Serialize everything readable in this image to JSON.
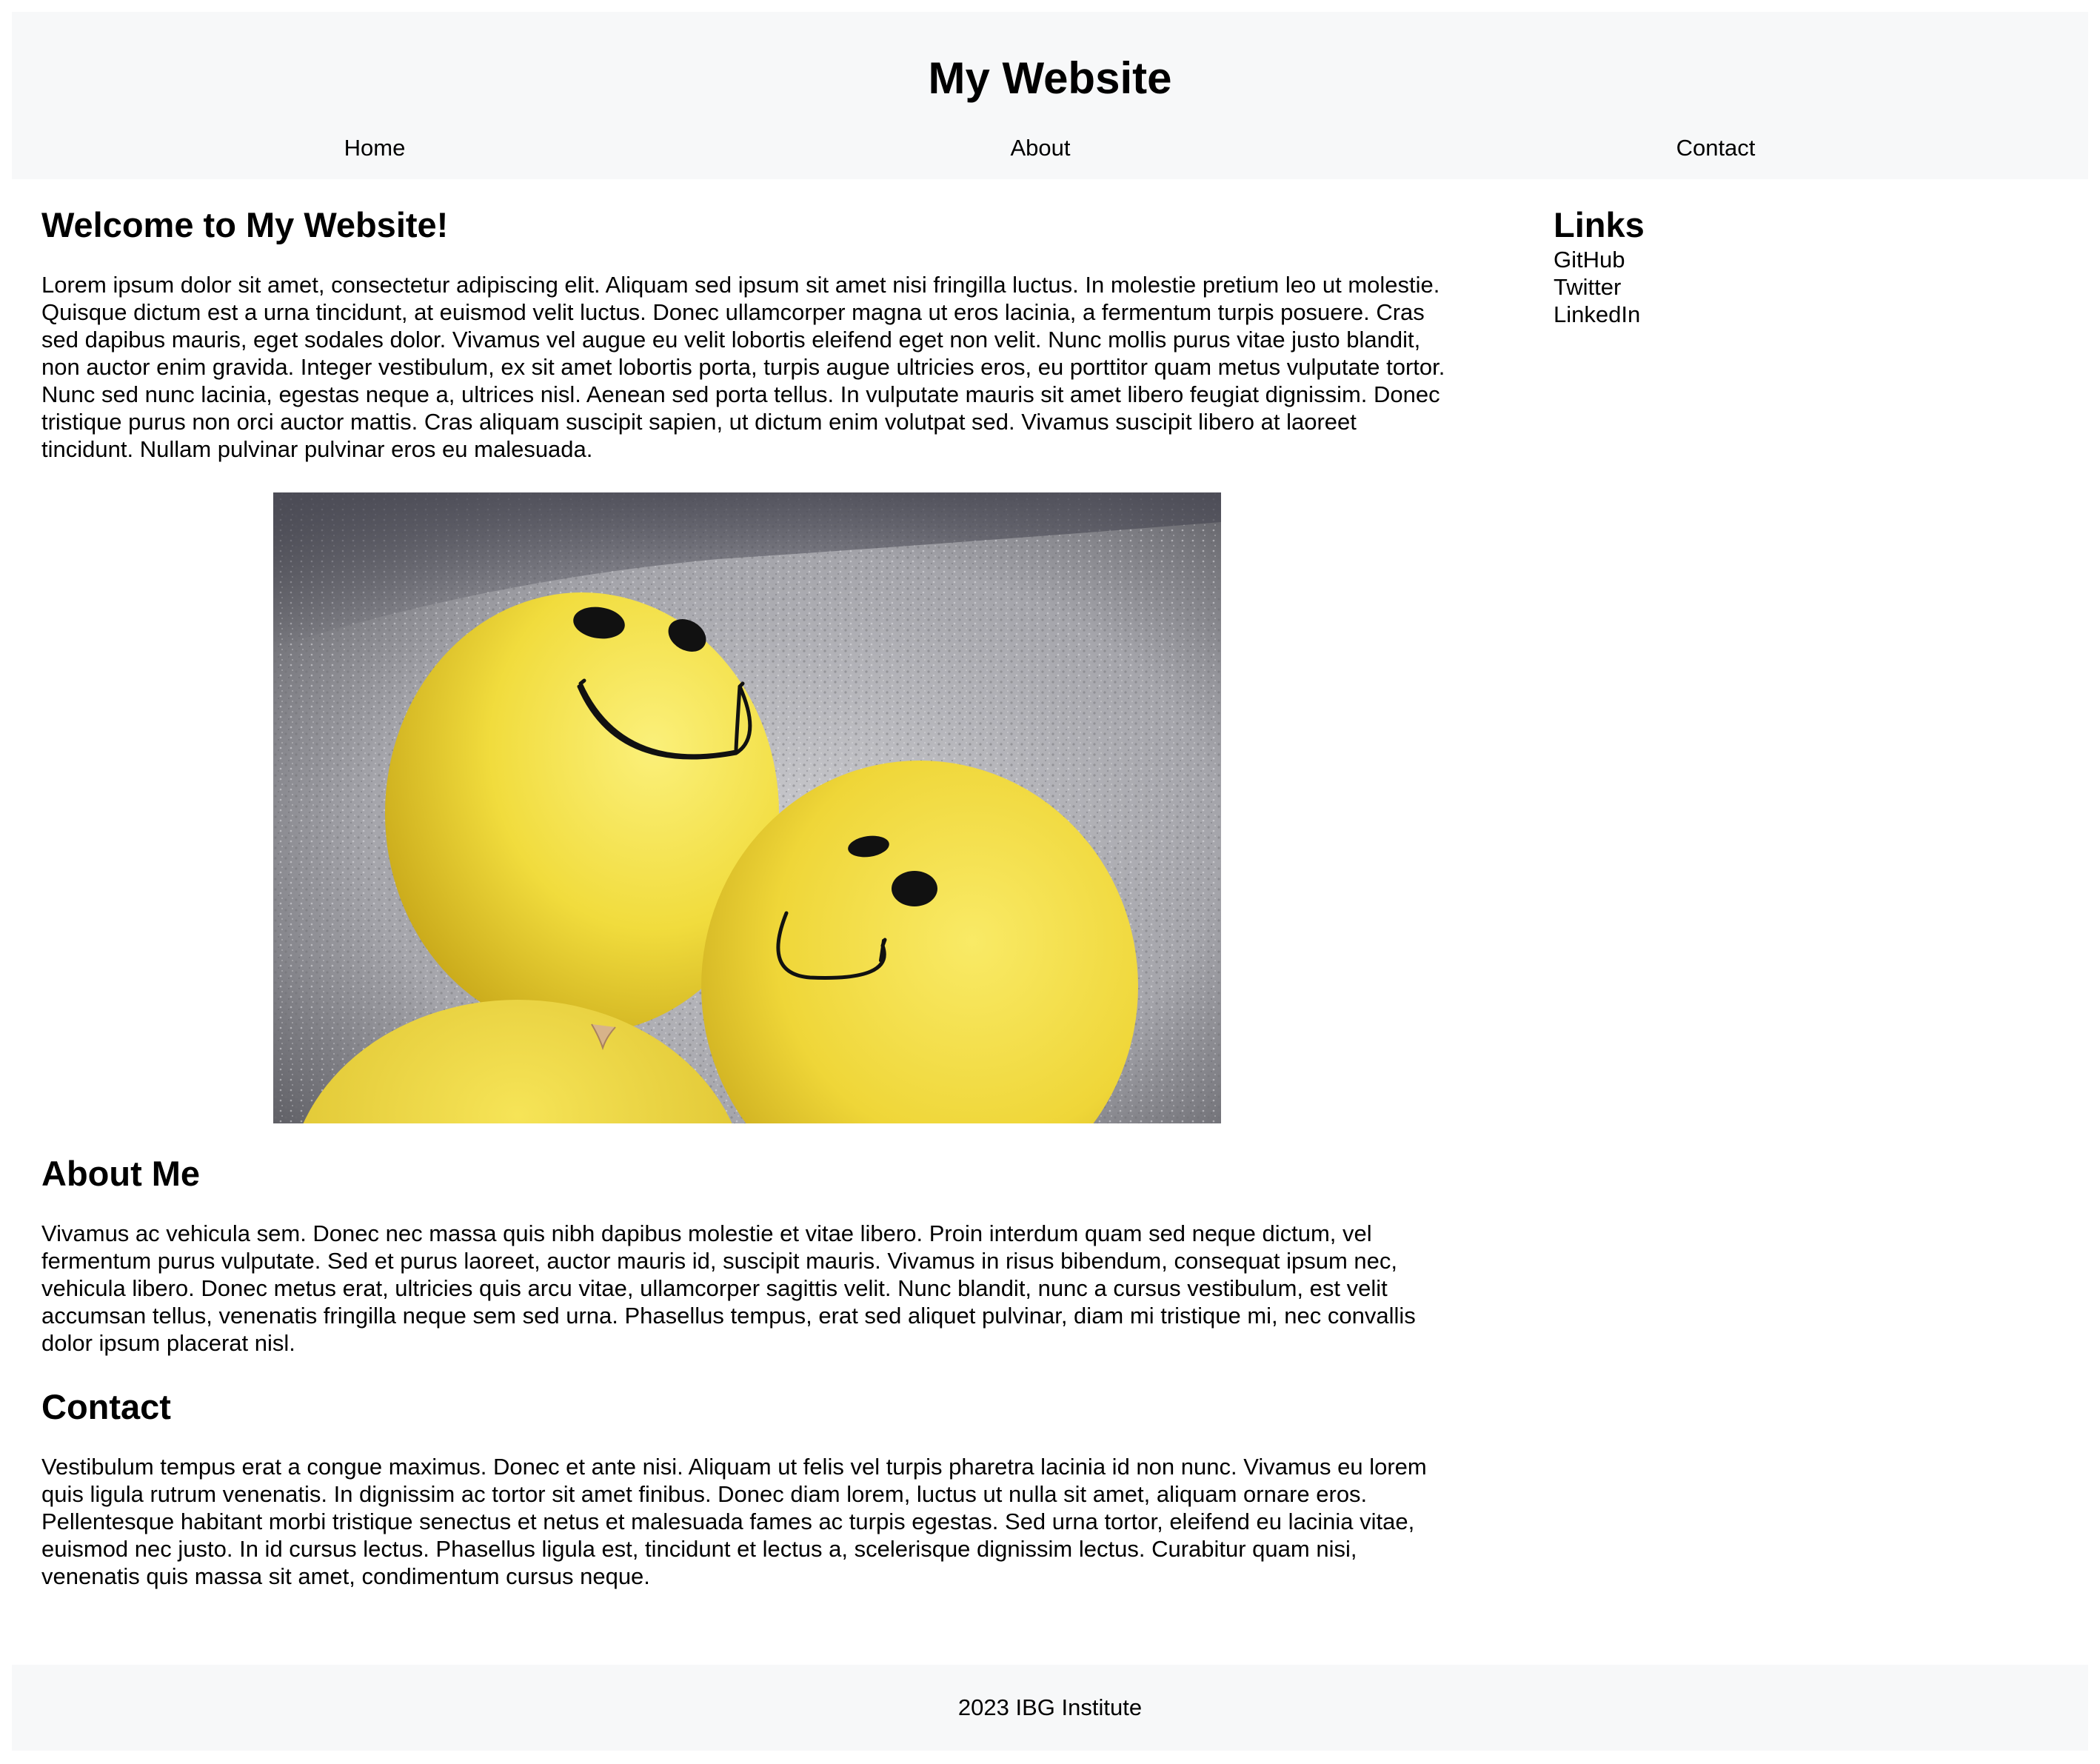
{
  "header": {
    "title": "My Website",
    "nav": [
      "Home",
      "About",
      "Contact"
    ]
  },
  "main": {
    "welcome": {
      "heading": "Welcome to My Website!",
      "body": "Lorem ipsum dolor sit amet, consectetur adipiscing elit. Aliquam sed ipsum sit amet nisi fringilla luctus. In molestie pretium leo ut molestie. Quisque dictum est a urna tincidunt, at euismod velit luctus. Donec ullamcorper magna ut eros lacinia, a fermentum turpis posuere. Cras sed dapibus mauris, eget sodales dolor. Vivamus vel augue eu velit lobortis eleifend eget non velit. Nunc mollis purus vitae justo blandit, non auctor enim gravida. Integer vestibulum, ex sit amet lobortis porta, turpis augue ultricies eros, eu porttitor quam metus vulputate tortor. Nunc sed nunc lacinia, egestas neque a, ultrices nisl. Aenean sed porta tellus. In vulputate mauris sit amet libero feugiat dignissim. Donec tristique purus non orci auctor mattis. Cras aliquam suscipit sapien, ut dictum enim volutpat sed. Vivamus suscipit libero at laoreet tincidunt. Nullam pulvinar pulvinar eros eu malesuada."
    },
    "about": {
      "heading": "About Me",
      "body": "Vivamus ac vehicula sem. Donec nec massa quis nibh dapibus molestie et vitae libero. Proin interdum quam sed neque dictum, vel fermentum purus vulputate. Sed et purus laoreet, auctor mauris id, suscipit mauris. Vivamus in risus bibendum, consequat ipsum nec, vehicula libero. Donec metus erat, ultricies quis arcu vitae, ullamcorper sagittis velit. Nunc blandit, nunc a cursus vestibulum, est velit accumsan tellus, venenatis fringilla neque sem sed urna. Phasellus tempus, erat sed aliquet pulvinar, diam mi tristique mi, nec convallis dolor ipsum placerat nisl."
    },
    "contact": {
      "heading": "Contact",
      "body": "Vestibulum tempus erat a congue maximus. Donec et ante nisi. Aliquam ut felis vel turpis pharetra lacinia id non nunc. Vivamus eu lorem quis ligula rutrum venenatis. In dignissim ac tortor sit amet finibus. Donec diam lorem, luctus ut nulla sit amet, aliquam ornare eros. Pellentesque habitant morbi tristique senectus et netus et malesuada fames ac turpis egestas. Sed urna tortor, eleifend eu lacinia vitae, euismod nec justo. In id cursus lectus. Phasellus ligula est, tincidunt et lectus a, scelerisque dignissim lectus. Curabitur quam nisi, venenatis quis massa sit amet, condimentum cursus neque."
    }
  },
  "sidebar": {
    "heading": "Links",
    "links": [
      "GitHub",
      "Twitter",
      "LinkedIn"
    ]
  },
  "footer": {
    "text": "2023 IBG Institute"
  },
  "colors": {
    "band_background": "#f7f8f9",
    "balloon_yellow": "#f2dc3c",
    "wall_gray": "#8f8f95"
  }
}
